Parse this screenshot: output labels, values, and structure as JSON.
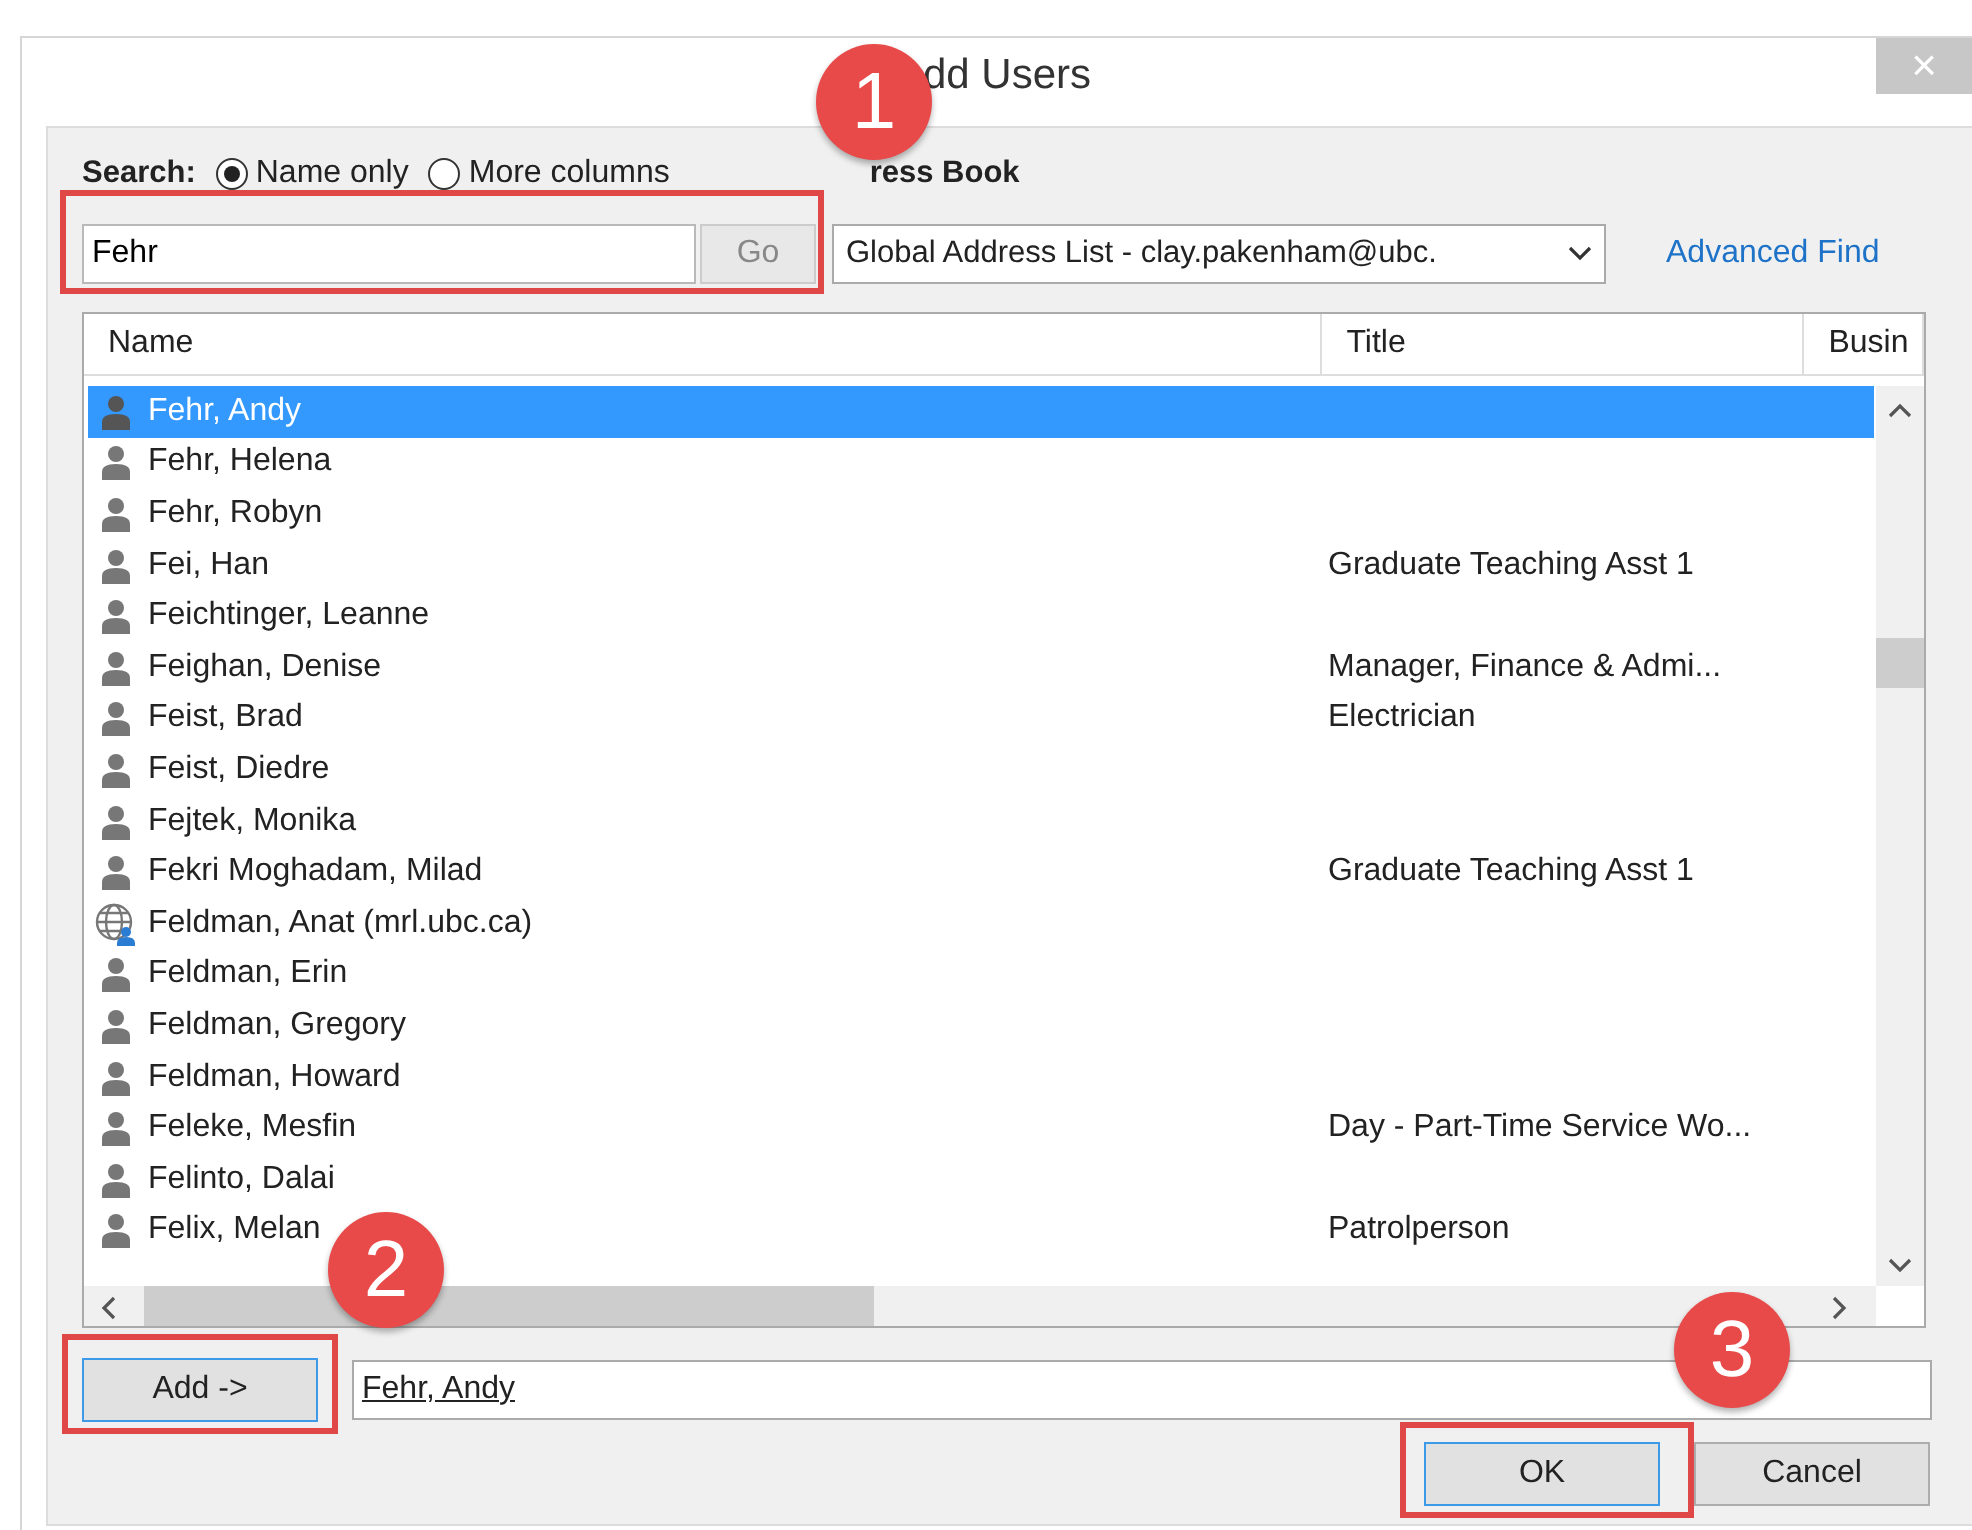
{
  "window": {
    "title": "dd Users",
    "close": "×"
  },
  "search": {
    "label": "Search:",
    "options": [
      {
        "label": "Name only",
        "selected": true
      },
      {
        "label": "More columns",
        "selected": false
      }
    ],
    "value": "Fehr",
    "go": "Go"
  },
  "address_book": {
    "label": "ress Book",
    "value": "Global Address List - clay.pakenham@ubc.",
    "link": "Advanced Find"
  },
  "table": {
    "columns": [
      "Name",
      "Title",
      "Busin"
    ],
    "rows": [
      {
        "kind": "person",
        "name": "Fehr, Andy",
        "title": "",
        "selected": true
      },
      {
        "kind": "person",
        "name": "Fehr, Helena",
        "title": "",
        "selected": false
      },
      {
        "kind": "person",
        "name": "Fehr, Robyn",
        "title": "",
        "selected": false
      },
      {
        "kind": "person",
        "name": "Fei, Han",
        "title": "Graduate Teaching Asst 1",
        "selected": false
      },
      {
        "kind": "person",
        "name": "Feichtinger, Leanne",
        "title": "",
        "selected": false
      },
      {
        "kind": "person",
        "name": "Feighan, Denise",
        "title": "Manager, Finance & Admi...",
        "selected": false
      },
      {
        "kind": "person",
        "name": "Feist, Brad",
        "title": "Electrician",
        "selected": false
      },
      {
        "kind": "person",
        "name": "Feist, Diedre",
        "title": "",
        "selected": false
      },
      {
        "kind": "person",
        "name": "Fejtek, Monika",
        "title": "",
        "selected": false
      },
      {
        "kind": "person",
        "name": "Fekri Moghadam, Milad",
        "title": "Graduate Teaching Asst 1",
        "selected": false
      },
      {
        "kind": "external",
        "name": "Feldman, Anat (mrl.ubc.ca)",
        "title": "",
        "selected": false
      },
      {
        "kind": "person",
        "name": "Feldman, Erin",
        "title": "",
        "selected": false
      },
      {
        "kind": "person",
        "name": "Feldman, Gregory",
        "title": "",
        "selected": false
      },
      {
        "kind": "person",
        "name": "Feldman, Howard",
        "title": "",
        "selected": false
      },
      {
        "kind": "person",
        "name": "Feleke, Mesfin",
        "title": "Day - Part-Time Service Wo...",
        "selected": false
      },
      {
        "kind": "person",
        "name": "Felinto, Dalai",
        "title": "",
        "selected": false
      },
      {
        "kind": "person",
        "name": "Felix, Melan",
        "title": "Patrolperson",
        "selected": false
      }
    ]
  },
  "add": {
    "button": "Add ->",
    "value": "Fehr, Andy"
  },
  "buttons": [
    {
      "label": "OK",
      "kind": "default"
    },
    {
      "label": "Cancel",
      "kind": "normal"
    }
  ],
  "callouts": [
    "1",
    "2",
    "3"
  ]
}
